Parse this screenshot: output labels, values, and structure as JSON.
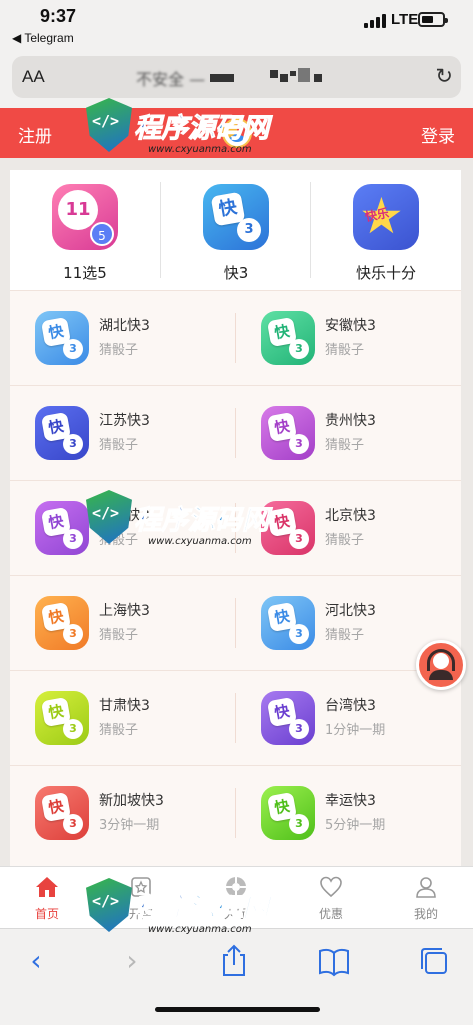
{
  "status_bar": {
    "time": "9:37",
    "back_app": "◀ Telegram",
    "network": "LTE"
  },
  "browser": {
    "aa_label": "AA",
    "url_text": "不安全 —"
  },
  "header": {
    "register": "注册",
    "login": "登录"
  },
  "top_categories": [
    {
      "label": "11选5",
      "ball": "11",
      "ball2": "5"
    },
    {
      "label": "快3",
      "die": "快",
      "ball": "3"
    },
    {
      "label": "快乐十分",
      "badge": "快乐"
    }
  ],
  "games": [
    {
      "name": "湖北快3",
      "sub": "猜骰子",
      "color1": "#7fc6f6",
      "color2": "#3b8be6"
    },
    {
      "name": "安徽快3",
      "sub": "猜骰子",
      "color1": "#5fe0a4",
      "color2": "#22b377"
    },
    {
      "name": "江苏快3",
      "sub": "猜骰子",
      "color1": "#5b6ff0",
      "color2": "#3846c9"
    },
    {
      "name": "贵州快3",
      "sub": "猜骰子",
      "color1": "#d77ae8",
      "color2": "#a33fc8"
    },
    {
      "name": "湖南快3",
      "sub": "猜骰子",
      "color1": "#c66ff0",
      "color2": "#9146d4"
    },
    {
      "name": "北京快3",
      "sub": "猜骰子",
      "color1": "#f56b9c",
      "color2": "#d93468"
    },
    {
      "name": "上海快3",
      "sub": "猜骰子",
      "color1": "#ffb24f",
      "color2": "#f07a27"
    },
    {
      "name": "河北快3",
      "sub": "猜骰子",
      "color1": "#7fc6f6",
      "color2": "#3b8be6"
    },
    {
      "name": "甘肃快3",
      "sub": "猜骰子",
      "color1": "#d6ef3c",
      "color2": "#9ccb16"
    },
    {
      "name": "台湾快3",
      "sub": "1分钟一期",
      "color1": "#a77af0",
      "color2": "#6a3fd0"
    },
    {
      "name": "新加坡快3",
      "sub": "3分钟一期",
      "color1": "#f77a70",
      "color2": "#dd3f3a"
    },
    {
      "name": "幸运快3",
      "sub": "5分钟一期",
      "color1": "#9bf04e",
      "color2": "#4fbf1a"
    }
  ],
  "die_char": "快",
  "die_num": "3",
  "tabs": [
    {
      "label": "首页",
      "icon": "home-icon",
      "active": true
    },
    {
      "label": "开奖",
      "icon": "star-calendar-icon",
      "active": false
    },
    {
      "label": "大厅",
      "icon": "hall-icon",
      "active": false
    },
    {
      "label": "优惠",
      "icon": "heart-icon",
      "active": false
    },
    {
      "label": "我的",
      "icon": "user-icon",
      "active": false
    }
  ],
  "watermark": {
    "text_a": "程序",
    "text_b": "源码网",
    "url": "www.cxyuanma.com"
  },
  "colors": {
    "header_red": "#f04a45",
    "active_tab": "#e8433f",
    "safari_blue": "#2f6fe0"
  }
}
